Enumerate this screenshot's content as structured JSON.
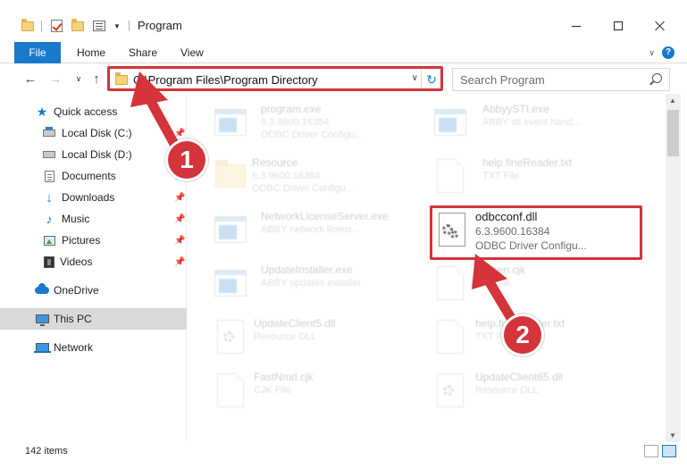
{
  "window": {
    "title": "Program"
  },
  "ribbon": {
    "tabs": [
      "File",
      "Home",
      "Share",
      "View"
    ]
  },
  "address": {
    "path": "C:\\Program Files\\Program Directory"
  },
  "search": {
    "placeholder": "Search Program"
  },
  "sidebar": {
    "items": [
      {
        "label": "Quick access",
        "icon": "star-icon",
        "pinned": false
      },
      {
        "label": "Local Disk (C:)",
        "icon": "drive-icon",
        "pinned": true
      },
      {
        "label": "Local Disk (D:)",
        "icon": "drive-icon",
        "pinned": true
      },
      {
        "label": "Documents",
        "icon": "documents-icon",
        "pinned": true
      },
      {
        "label": "Downloads",
        "icon": "download-icon",
        "pinned": true
      },
      {
        "label": "Music",
        "icon": "music-icon",
        "pinned": true
      },
      {
        "label": "Pictures",
        "icon": "pictures-icon",
        "pinned": true
      },
      {
        "label": "Videos",
        "icon": "videos-icon",
        "pinned": true
      },
      {
        "label": "OneDrive",
        "icon": "cloud-icon",
        "pinned": false
      },
      {
        "label": "This PC",
        "icon": "computer-icon",
        "pinned": false,
        "selected": true
      },
      {
        "label": "Network",
        "icon": "network-icon",
        "pinned": false
      }
    ]
  },
  "files": [
    {
      "name": "program.exe",
      "line2": "6.3.9600.16384",
      "line3": "ODBC Driver Configu...",
      "type": "exe"
    },
    {
      "name": "AbbyySTI.exe",
      "line2": "ABBY sti event hand...",
      "line3": "",
      "type": "exe"
    },
    {
      "name": "Resource",
      "line2": "6.3.9600.16384",
      "line3": "ODBC Driver Configu...",
      "type": "folder"
    },
    {
      "name": "help.fineReader.txt",
      "line2": "TXT File",
      "line3": "",
      "type": "file"
    },
    {
      "name": "NetworkLicenseServer.exe",
      "line2": "ABBY network licens...",
      "line3": "",
      "type": "exe"
    },
    {
      "name": "odbcconf.dll",
      "line2": "6.3.9600.16384",
      "line3": "ODBC Driver Configu...",
      "type": "dll"
    },
    {
      "name": "UpdateInstaller.exe",
      "line2": "ABBY updates installer",
      "line3": "",
      "type": "exe"
    },
    {
      "name": "Kitchen.cjk",
      "line2": "CJK File",
      "line3": "",
      "type": "file"
    },
    {
      "name": "UpdateClient5.dll",
      "line2": "Resource DLL",
      "line3": "",
      "type": "dll"
    },
    {
      "name": "help.fineReader.txt",
      "line2": "TXT File",
      "line3": "",
      "type": "file"
    },
    {
      "name": "FastNmrl.cjk",
      "line2": "CJK File",
      "line3": "",
      "type": "file"
    },
    {
      "name": "UpdateClient65.dll",
      "line2": "Resource DLL",
      "line3": "",
      "type": "dll"
    }
  ],
  "status": {
    "item_count": "142 items"
  },
  "annotations": {
    "badge1": "1",
    "badge2": "2",
    "color": "#d4343a"
  },
  "colors": {
    "accent": "#1979ca"
  }
}
